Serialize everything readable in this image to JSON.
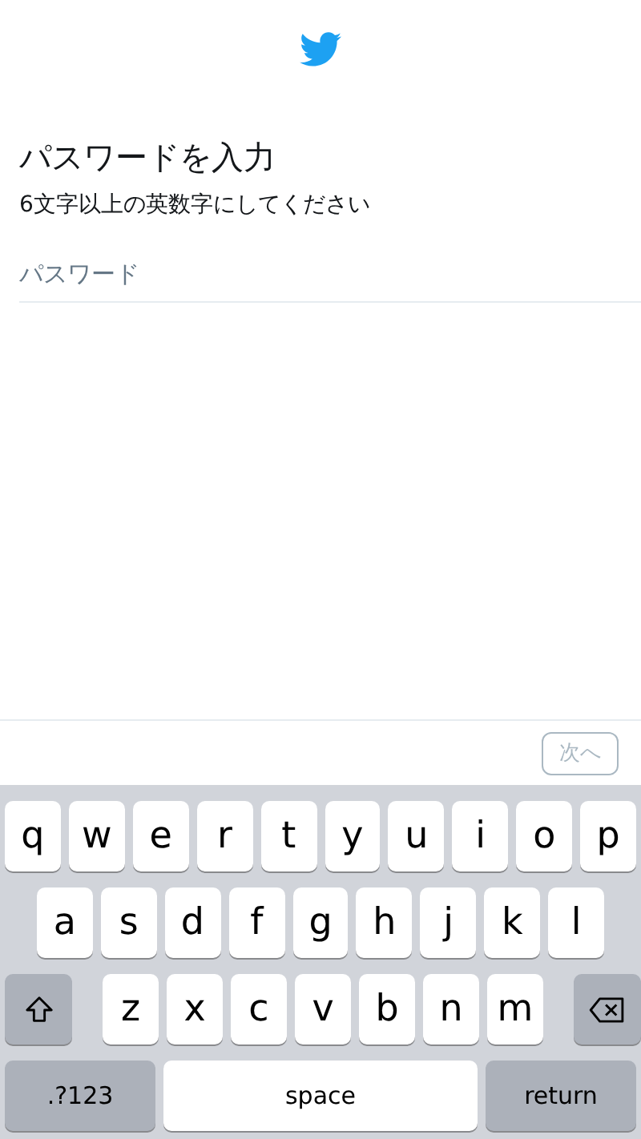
{
  "header": {
    "title": "パスワードを入力",
    "subtitle": "6文字以上の英数字にしてください"
  },
  "password_field": {
    "placeholder": "パスワード"
  },
  "toolbar": {
    "next_button": {
      "label": "次へ",
      "disabled": true
    }
  },
  "keyboard": {
    "rows": [
      {
        "keys": [
          {
            "kind": "letter",
            "label": "q"
          },
          {
            "kind": "letter",
            "label": "w"
          },
          {
            "kind": "letter",
            "label": "e"
          },
          {
            "kind": "letter",
            "label": "r"
          },
          {
            "kind": "letter",
            "label": "t"
          },
          {
            "kind": "letter",
            "label": "y"
          },
          {
            "kind": "letter",
            "label": "u"
          },
          {
            "kind": "letter",
            "label": "i"
          },
          {
            "kind": "letter",
            "label": "o"
          },
          {
            "kind": "letter",
            "label": "p"
          }
        ]
      },
      {
        "keys": [
          {
            "kind": "letter",
            "label": "a"
          },
          {
            "kind": "letter",
            "label": "s"
          },
          {
            "kind": "letter",
            "label": "d"
          },
          {
            "kind": "letter",
            "label": "f"
          },
          {
            "kind": "letter",
            "label": "g"
          },
          {
            "kind": "letter",
            "label": "h"
          },
          {
            "kind": "letter",
            "label": "j"
          },
          {
            "kind": "letter",
            "label": "k"
          },
          {
            "kind": "letter",
            "label": "l"
          }
        ]
      },
      {
        "keys": [
          {
            "kind": "shift"
          },
          {
            "kind": "letter",
            "label": "z"
          },
          {
            "kind": "letter",
            "label": "x"
          },
          {
            "kind": "letter",
            "label": "c"
          },
          {
            "kind": "letter",
            "label": "v"
          },
          {
            "kind": "letter",
            "label": "b"
          },
          {
            "kind": "letter",
            "label": "n"
          },
          {
            "kind": "letter",
            "label": "m"
          },
          {
            "kind": "delete"
          }
        ]
      },
      {
        "keys": [
          {
            "kind": "mode",
            "label": ".?123"
          },
          {
            "kind": "space",
            "label": "space"
          },
          {
            "kind": "return",
            "label": "return"
          }
        ]
      }
    ]
  }
}
